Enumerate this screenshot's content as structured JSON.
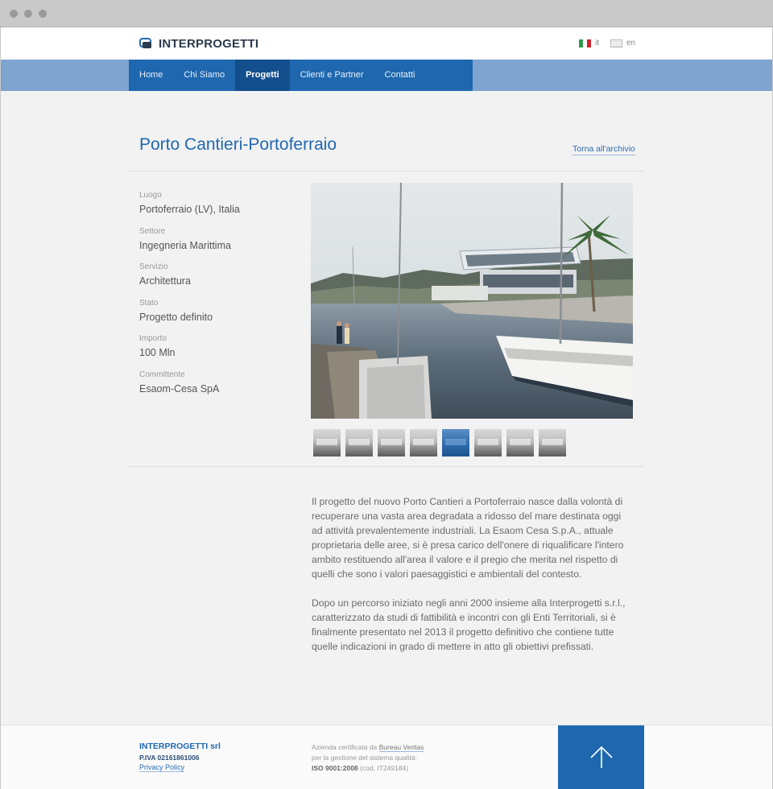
{
  "header": {
    "logo_text": "INTERPROGETTI",
    "languages": [
      {
        "code": "it",
        "label": "it"
      },
      {
        "code": "en",
        "label": "en"
      }
    ]
  },
  "nav": {
    "items": [
      {
        "label": "Home",
        "active": false
      },
      {
        "label": "Chi Siamo",
        "active": false
      },
      {
        "label": "Progetti",
        "active": true
      },
      {
        "label": "Clienti e Partner",
        "active": false
      },
      {
        "label": "Contatti",
        "active": false
      }
    ]
  },
  "project": {
    "title": "Porto Cantieri-Portoferraio",
    "back_link": "Torna all'archivio",
    "details": [
      {
        "label": "Luogo",
        "value": "Portoferraio (LV), Italia"
      },
      {
        "label": "Settore",
        "value": "Ingegneria Marittima"
      },
      {
        "label": "Servizio",
        "value": "Architettura"
      },
      {
        "label": "Stato",
        "value": "Progetto definito"
      },
      {
        "label": "Importo",
        "value": "100 Mln"
      },
      {
        "label": "Committente",
        "value": "Esaom-Cesa SpA"
      }
    ],
    "thumbnail_count": 8,
    "active_thumbnail": 5,
    "description": [
      "Il progetto del nuovo Porto Cantieri a Portoferraio nasce dalla volontà di recuperare una vasta area degradata a ridosso del mare destinata oggi ad attività prevalentemente industriali. La Esaom Cesa S.p.A., attuale proprietaria delle aree, si è presa carico dell'onere di riqualificare l'intero ambito restituendo all'area il valore e il pregio che merita nel rispetto di quelli che sono i valori paesaggistici e ambientali del contesto.",
      "Dopo un percorso iniziato negli anni 2000 insieme alla Interprogetti s.r.l., caratterizzato da studi di fattibilità e incontri con gli Enti Territoriali, si è finalmente presentato nel 2013 il progetto definitivo che contiene tutte quelle indicazioni in grado di mettere in atto gli obiettivi prefissati."
    ]
  },
  "footer": {
    "company": "INTERPROGETTI srl",
    "piva": "P.IVA 02161861006",
    "privacy": "Privacy Policy",
    "cert_line1_prefix": "Azienda certificata da ",
    "cert_link": "Bureau Veritas",
    "cert_line2": "per la gestione del sistema qualità:",
    "cert_iso": "ISO 9001:2008",
    "cert_code": " (cod. IT249184)"
  },
  "colors": {
    "brand_blue": "#1f68b0",
    "nav_dark": "#134f8c",
    "nav_bar": "#7ea4cf"
  }
}
